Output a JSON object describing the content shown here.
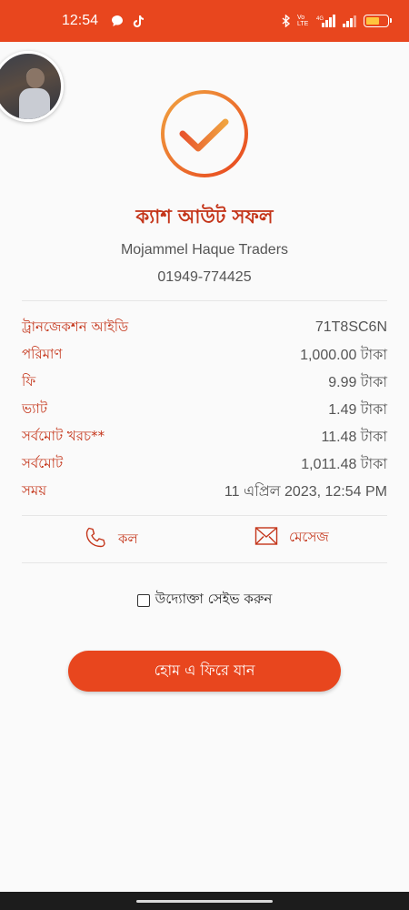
{
  "status_bar": {
    "time": "12:54",
    "icons": [
      "chat-bubble-icon",
      "tiktok-icon",
      "bluetooth-icon",
      "volte-icon",
      "signal-4g-icon",
      "signal-icon",
      "battery-icon"
    ],
    "volte_label": "Vo LTE",
    "network_label": "4G"
  },
  "header": {
    "title": "ক্যাশ আউট সফল",
    "merchant_name": "Mojammel Haque Traders",
    "merchant_phone": "01949-774425"
  },
  "details": [
    {
      "label": "ট্রানজেকশন আইডি",
      "value": "71T8SC6N"
    },
    {
      "label": "পরিমাণ",
      "value": "1,000.00 টাকা"
    },
    {
      "label": "ফি",
      "value": "9.99 টাকা"
    },
    {
      "label": "ভ্যাট",
      "value": "1.49 টাকা"
    },
    {
      "label": "সর্বমোট খরচ**",
      "value": "11.48 টাকা"
    },
    {
      "label": "সর্বমোট",
      "value": "1,011.48 টাকা"
    },
    {
      "label": "সময়",
      "value": "11 এপ্রিল 2023, 12:54 PM"
    }
  ],
  "actions": {
    "call_label": "কল",
    "message_label": "মেসেজ"
  },
  "save": {
    "label": "উদ্যোক্তা সেইভ করুন",
    "checked": false
  },
  "home_button": {
    "label": "হোম এ ফিরে যান"
  },
  "colors": {
    "accent": "#e8461e",
    "text_accent": "#c4351a",
    "check_gradient_start": "#f0943a",
    "check_gradient_end": "#e8461e"
  }
}
